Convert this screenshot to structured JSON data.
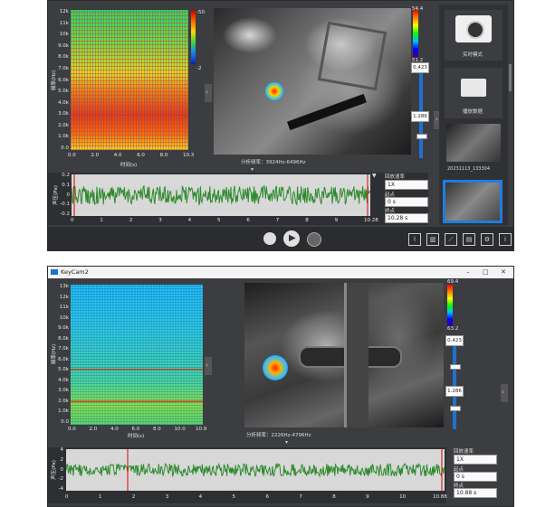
{
  "window1": {
    "spectrogram": {
      "y_ticks": [
        "12k",
        "11k",
        "10k",
        "9.0k",
        "8.0k",
        "7.0k",
        "6.0k",
        "5.0k",
        "4.0k",
        "3.0k",
        "2.0k",
        "1.0k",
        "0.0"
      ],
      "x_ticks": [
        "0.0",
        "2.0",
        "4.0",
        "6.0",
        "8.0",
        "10.3"
      ],
      "xlabel": "时间(s)",
      "ylabel": "频率(Hz)",
      "colorbar_max": "-50",
      "colorbar_min": "-2"
    },
    "camera": {
      "colorbar_max": "54.4",
      "colorbar_min": "51.2",
      "slider_top": "0.423",
      "slider_bottom": "1.286",
      "caption": "分析频率：3924Hz-6496Hz"
    },
    "right_panel": {
      "snapshot_label": "实时模式",
      "folder_label": "播放数据",
      "thumb_label": "20231113_133304"
    },
    "waveform": {
      "y_ticks": [
        "0.2",
        "0.1",
        "0",
        "-0.1",
        "-0.2"
      ],
      "ylabel": "声压(Pa)",
      "x_ticks": [
        "0",
        "1",
        "2",
        "3",
        "4",
        "5",
        "6",
        "7",
        "8",
        "9",
        "10.28"
      ]
    },
    "controls": {
      "speed_label": "回放速率",
      "speed_value": "1X",
      "start_label": "起点",
      "start_value": "0 s",
      "end_label": "终点",
      "end_value": "10.28 s"
    }
  },
  "window2": {
    "title": "KeyCam2",
    "spectrogram": {
      "y_ticks": [
        "13k",
        "12k",
        "11k",
        "10k",
        "9.0k",
        "8.0k",
        "7.0k",
        "6.0k",
        "5.0k",
        "4.0k",
        "3.0k",
        "2.0k",
        "1.0k",
        "0.0"
      ],
      "x_ticks": [
        "0.0",
        "2.0",
        "4.0",
        "6.0",
        "8.0",
        "10.0",
        "10.9"
      ],
      "xlabel": "时间(s)",
      "ylabel": "频率(Hz)"
    },
    "camera": {
      "colorbar_max": "69.4",
      "colorbar_min": "63.2",
      "slider_top": "0.423",
      "slider_bottom": "1.286",
      "caption": "分析频率：2226Hz-4796Hz"
    },
    "waveform": {
      "y_ticks": [
        "4",
        "2",
        "0",
        "-2",
        "-4"
      ],
      "ylabel": "声压(Pa)",
      "x_ticks": [
        "0",
        "1",
        "2",
        "3",
        "4",
        "5",
        "6",
        "7",
        "8",
        "9",
        "10",
        "10.88"
      ]
    },
    "controls": {
      "speed_label": "回放速率",
      "speed_value": "1X",
      "start_label": "起点",
      "start_value": "0 s",
      "end_label": "终点",
      "end_value": "10.88 s"
    }
  }
}
